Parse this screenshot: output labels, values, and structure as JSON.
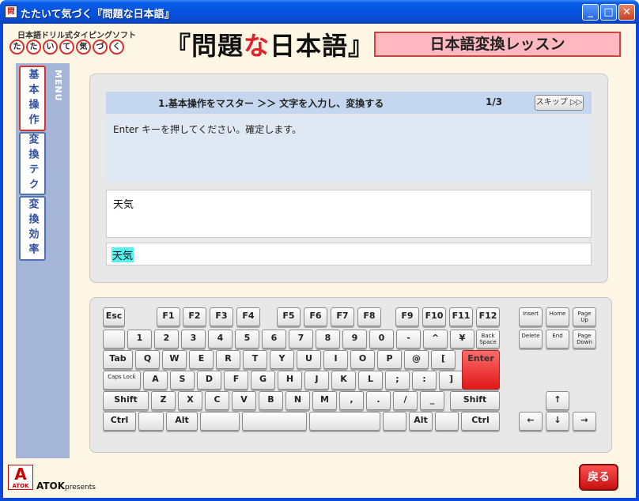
{
  "window": {
    "title": "たたいて気づく『問題な日本語』",
    "min_glyph": "_",
    "max_glyph": "□",
    "close_glyph": "✕"
  },
  "header": {
    "subtitle": "日本語ドリル式タイピングソフト",
    "chars": [
      "た",
      "た",
      "い",
      "て",
      "気",
      "づ",
      "く"
    ],
    "logo_pre": "『問題",
    "logo_na": "な",
    "logo_post": "日本語』",
    "lesson_title": "日本語変換レッスン"
  },
  "menu": {
    "label": "MENU",
    "items": [
      {
        "label": "基本操作",
        "active": true
      },
      {
        "label": "変換テク",
        "active": false
      },
      {
        "label": "変換効率",
        "active": false
      }
    ]
  },
  "lesson": {
    "question": "1.基本操作をマスター ＞＞ 文字を入力し、変換する",
    "count": "1/3",
    "skip_label": "スキップ ▷▷",
    "instruction": "Enter キーを押してください。確定します。",
    "answer": "天気",
    "input": "天気"
  },
  "keyboard": {
    "rows": {
      "fn": [
        "Esc",
        "F1",
        "F2",
        "F3",
        "F4",
        "F5",
        "F6",
        "F7",
        "F8",
        "F9",
        "F10",
        "F11",
        "F12"
      ],
      "num": [
        "1",
        "2",
        "3",
        "4",
        "5",
        "6",
        "7",
        "8",
        "9",
        "0",
        "-",
        "^",
        "¥",
        "Back Space"
      ],
      "top": [
        "Tab",
        "Q",
        "W",
        "E",
        "R",
        "T",
        "Y",
        "U",
        "I",
        "O",
        "P",
        "@",
        "["
      ],
      "home": [
        "Caps Lock",
        "A",
        "S",
        "D",
        "F",
        "G",
        "H",
        "J",
        "K",
        "L",
        ";",
        ":",
        "]"
      ],
      "bottom": [
        "Shift",
        "Z",
        "X",
        "C",
        "V",
        "B",
        "N",
        "M",
        ",",
        ".",
        "/",
        "_",
        "Shift"
      ],
      "space": [
        "Ctrl",
        "Alt",
        "Alt",
        "Ctrl"
      ]
    },
    "enter": "Enter",
    "nav": [
      "Insert",
      "Home",
      "Page Up",
      "Delete",
      "End",
      "Page Down"
    ],
    "arrows": [
      "↑",
      "←",
      "↓",
      "→"
    ]
  },
  "footer": {
    "atok_logo": "A",
    "atok_logo_sub": "ATOK",
    "atok": "ATOK",
    "presents": "presents",
    "back_label": "戻る"
  },
  "colors": {
    "title_bar": "#0554e0",
    "lesson_title_bg": "#ffb8c0",
    "menu_bg": "#a5b5d8",
    "enter_key": "#e01818",
    "input_highlight": "#55f0f0"
  }
}
